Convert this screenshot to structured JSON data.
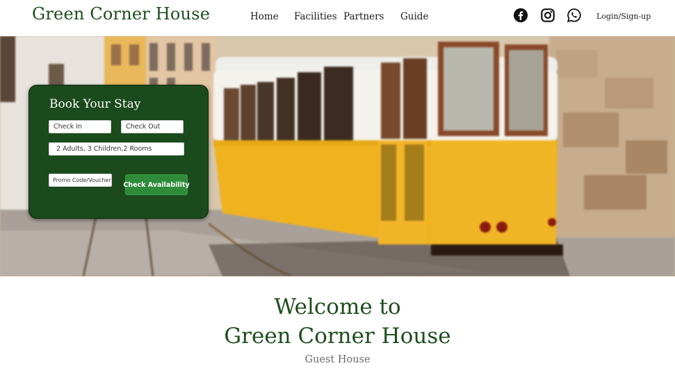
{
  "header": {
    "brand": "Green Corner House",
    "nav": [
      "Home",
      "Facilities",
      "Partners",
      "Guide"
    ],
    "social_icons": [
      "facebook-icon",
      "instagram-icon",
      "whatsapp-icon"
    ],
    "login": "Login/Sign-up"
  },
  "booking": {
    "title": "Book Your Stay",
    "check_in_placeholder": "Check In",
    "check_out_placeholder": "Check Out",
    "guests_value": "2 Adults, 3 Children,2 Rooms",
    "promo_placeholder": "Promo Code/Voucher",
    "check_button": "Check Availability"
  },
  "welcome": {
    "line1": "Welcome to",
    "line2": "Green Corner House",
    "subtitle": "Guest House"
  },
  "colors": {
    "brand_green": "#1e4d1e",
    "panel_green": "#1b4a1c",
    "button_green": "#2e8b3a",
    "tram_yellow": "#f0b21f"
  }
}
